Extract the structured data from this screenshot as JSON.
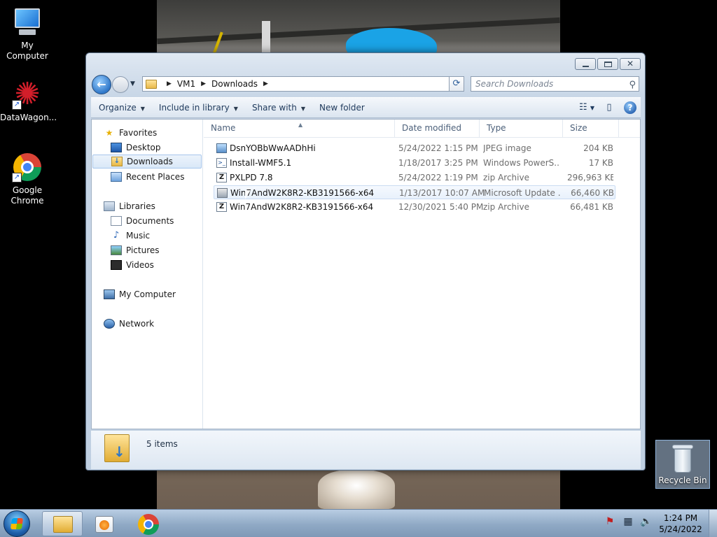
{
  "desktop": {
    "icons": [
      {
        "label": "My Computer",
        "icon": "my-computer-icon"
      },
      {
        "label": "DataWagon...",
        "icon": "datawagon-icon"
      },
      {
        "label": "Google Chrome",
        "icon": "chrome-icon"
      }
    ],
    "recycle_bin": {
      "label": "Recycle Bin",
      "icon": "recycle-bin-icon"
    }
  },
  "explorer": {
    "breadcrumb": [
      "VM1",
      "Downloads"
    ],
    "search_placeholder": "Search Downloads",
    "commands": [
      "Organize",
      "Include in library",
      "Share with",
      "New folder"
    ],
    "nav": {
      "favorites_label": "Favorites",
      "favorites": [
        "Desktop",
        "Downloads",
        "Recent Places"
      ],
      "selected": "Downloads",
      "libraries_label": "Libraries",
      "libraries": [
        "Documents",
        "Music",
        "Pictures",
        "Videos"
      ],
      "computer_label": "My Computer",
      "network_label": "Network"
    },
    "columns": [
      "Name",
      "Date modified",
      "Type",
      "Size"
    ],
    "files": [
      {
        "name": "DsnYOBbWwAADhHi",
        "date": "5/24/2022 1:15 PM",
        "type": "JPEG image",
        "size": "204 KB",
        "icon": "image-file-icon"
      },
      {
        "name": "Install-WMF5.1",
        "date": "1/18/2017 3:25 PM",
        "type": "Windows PowerS...",
        "size": "17 KB",
        "icon": "powershell-file-icon"
      },
      {
        "name": "PXLPD 7.8",
        "date": "5/24/2022 1:19 PM",
        "type": "zip Archive",
        "size": "296,963 KB",
        "icon": "zip-file-icon"
      },
      {
        "name": "Win7AndW2K8R2-KB3191566-x64",
        "date": "1/13/2017 10:07 AM",
        "type": "Microsoft Update ...",
        "size": "66,460 KB",
        "icon": "update-package-icon"
      },
      {
        "name": "Win7AndW2K8R2-KB3191566-x64",
        "date": "12/30/2021 5:40 PM",
        "type": "zip Archive",
        "size": "66,481 KB",
        "icon": "zip-file-icon"
      }
    ],
    "item_count": "5 items"
  },
  "taskbar": {
    "clock_time": "1:24 PM",
    "clock_date": "5/24/2022"
  },
  "colors": {
    "accent": "#1c5bd6",
    "selection": "#d9e8f8",
    "taskbar": "#8fa9c5"
  }
}
